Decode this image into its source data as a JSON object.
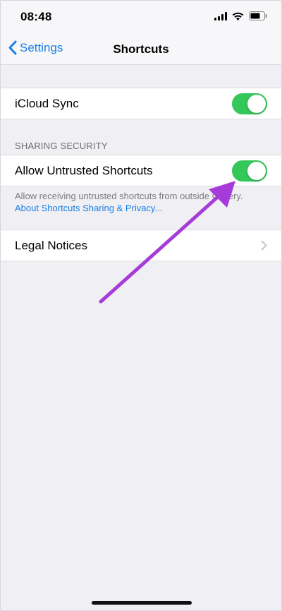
{
  "status_bar": {
    "time": "08:48"
  },
  "nav": {
    "back_label": "Settings",
    "title": "Shortcuts"
  },
  "sections": {
    "icloud": {
      "label": "iCloud Sync",
      "toggle_on": true
    },
    "sharing_security": {
      "header": "SHARING SECURITY",
      "label": "Allow Untrusted Shortcuts",
      "toggle_on": true,
      "footer_text": "Allow receiving untrusted shortcuts from outside Gallery.",
      "footer_link": "About Shortcuts Sharing & Privacy..."
    },
    "legal": {
      "label": "Legal Notices"
    }
  },
  "colors": {
    "accent": "#1a7fe6",
    "toggle_on": "#34c759",
    "annotation_arrow": "#a73bd9"
  },
  "icons": [
    "signal-icon",
    "wifi-icon",
    "battery-icon",
    "back-chevron-icon",
    "chevron-right-icon",
    "annotation-arrow-icon"
  ]
}
